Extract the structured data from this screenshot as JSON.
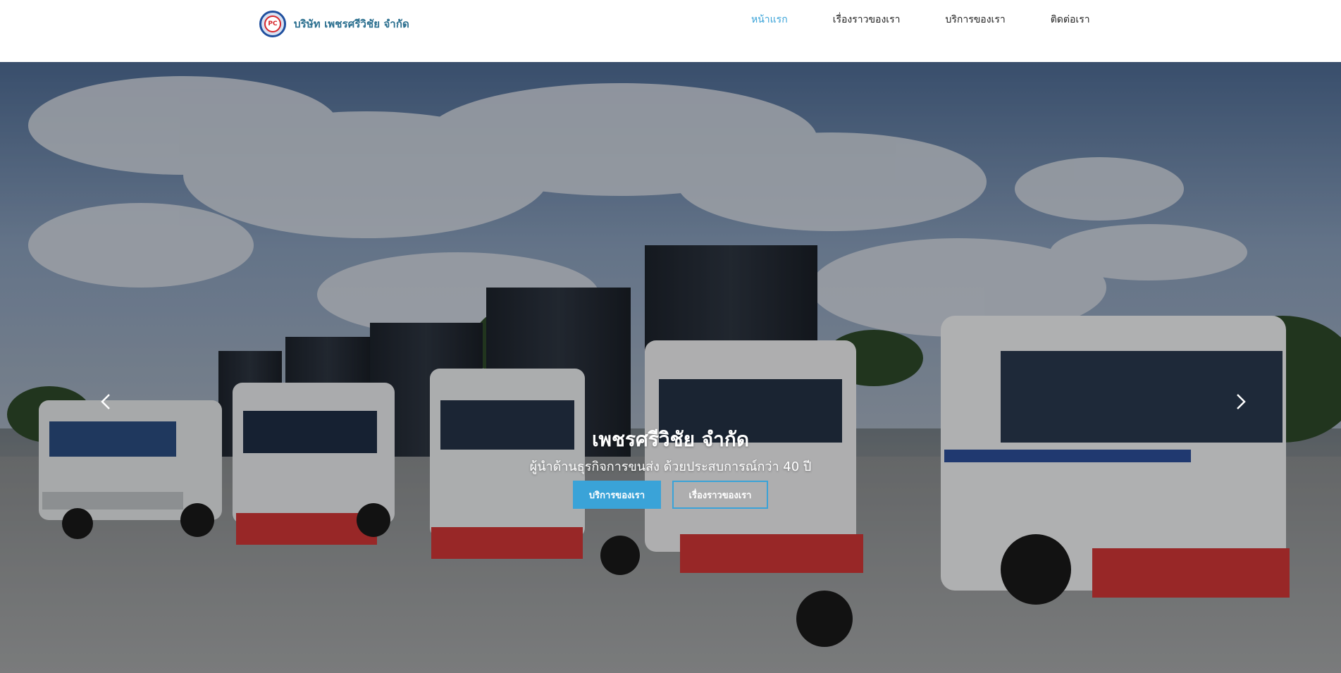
{
  "navbar": {
    "logo_text": "PC",
    "brand_name": "บริษัท เพชรศรีวิชัย จำกัด",
    "menu": [
      {
        "label": "หน้าแรก",
        "active": true
      },
      {
        "label": "เรื่องราวของเรา",
        "active": false
      },
      {
        "label": "บริการของเรา",
        "active": false
      },
      {
        "label": "ติดต่อเรา",
        "active": false
      }
    ],
    "active_color": "#3aa3d8"
  },
  "hero": {
    "title": "เพชรศรีวิชัย จำกัด",
    "subtitle": "ผู้นำด้านธุรกิจการขนส่ง ด้วยประสบการณ์กว่า 40 ปี",
    "primary_button": "บริการของเรา",
    "secondary_button": "เรื่องราวของเรา",
    "prev_icon": "chevron-left-icon",
    "next_icon": "chevron-right-icon",
    "accent_color": "#3aa3d8"
  }
}
